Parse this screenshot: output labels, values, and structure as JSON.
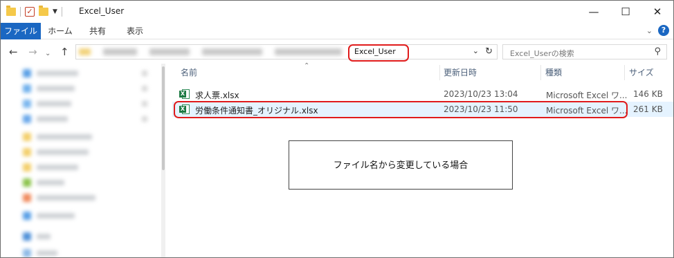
{
  "window": {
    "title": "Excel_User",
    "minimize_glyph": "—",
    "maximize_glyph": "☐",
    "close_glyph": "✕"
  },
  "ribbon": {
    "tabs": [
      "ファイル",
      "ホーム",
      "共有",
      "表示"
    ],
    "file_tab_color": "#1a67c2"
  },
  "address_bar": {
    "current_folder": "Excel_User",
    "path_blurred": true
  },
  "search": {
    "placeholder": "Excel_Userの検索"
  },
  "columns": {
    "name": "名前",
    "date": "更新日時",
    "type": "種類",
    "size": "サイズ"
  },
  "files": [
    {
      "name": "求人票.xlsx",
      "date": "2023/10/23 13:04",
      "type": "Microsoft Excel ワ...",
      "size": "146 KB",
      "icon": "excel-file-icon"
    },
    {
      "name": "労働条件通知書_オリジナル.xlsx",
      "date": "2023/10/23 11:50",
      "type": "Microsoft Excel ワ...",
      "size": "261 KB",
      "icon": "excel-file-icon",
      "selected": true
    }
  ],
  "callout": {
    "text": "ファイル名から変更している場合"
  },
  "highlight_color": "#e01b1b"
}
